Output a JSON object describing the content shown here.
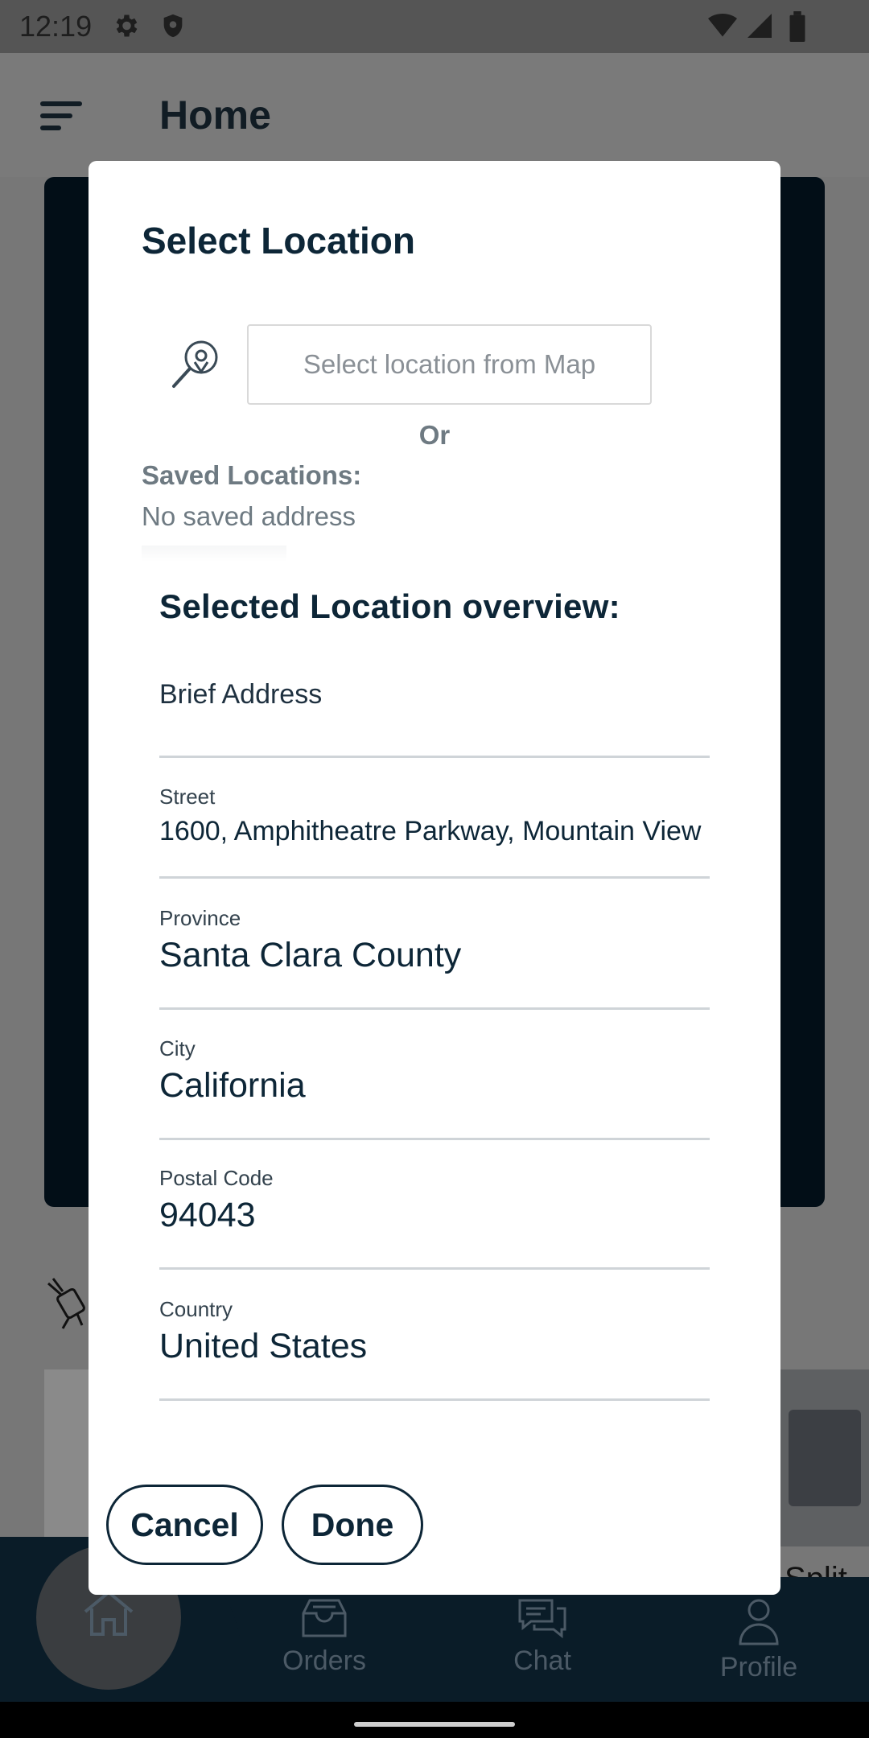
{
  "status_bar": {
    "time": "12:19",
    "icons": [
      "gear-icon",
      "shield-icon",
      "wifi-icon",
      "signal-icon",
      "battery-icon"
    ]
  },
  "app_bar": {
    "title": "Home",
    "menu_icon": "menu-icon"
  },
  "bottom_nav": {
    "items": [
      {
        "label": "",
        "icon": "home-icon",
        "active": true
      },
      {
        "label": "Orders",
        "icon": "orders-icon"
      },
      {
        "label": "Chat",
        "icon": "chat-icon"
      },
      {
        "label": "Profile",
        "icon": "profile-icon"
      }
    ]
  },
  "background": {
    "card_label": "Split A"
  },
  "dialog": {
    "title": "Select Location",
    "map_placeholder": "Select location from Map",
    "or_text": "Or",
    "saved_locations_label": "Saved Locations:",
    "saved_locations_value": "No saved address",
    "overview_title": "Selected Location overview:",
    "fields": {
      "brief_address": {
        "label": "",
        "value": "Brief Address"
      },
      "street": {
        "label": "Street",
        "value": "1600, Amphitheatre Parkway, Mountain View"
      },
      "province": {
        "label": "Province",
        "value": "Santa Clara County"
      },
      "city": {
        "label": "City",
        "value": "California"
      },
      "postal_code": {
        "label": "Postal Code",
        "value": "94043"
      },
      "country": {
        "label": "Country",
        "value": "United States"
      }
    },
    "buttons": {
      "cancel": "Cancel",
      "done": "Done"
    }
  },
  "colors": {
    "primary": "#0d2637",
    "scrim": "#777777",
    "nav_bg": "#0a1c28",
    "muted_text": "#6e7a82"
  }
}
